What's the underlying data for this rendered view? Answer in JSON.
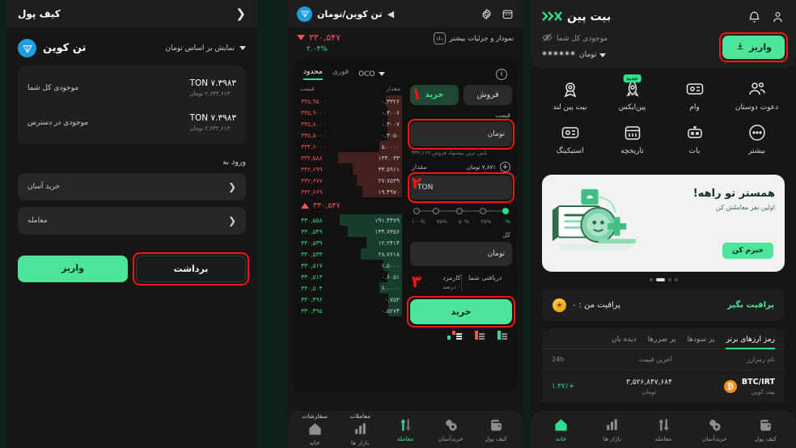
{
  "left": {
    "brand": {
      "name": "بیت پین",
      "mark": "》K"
    },
    "header_icons": [
      "user-icon",
      "bell-icon"
    ],
    "balance": {
      "label": "موجودی کل شما",
      "eye_icon": "eye-off-icon",
      "masked_value": "******",
      "unit": "تومان"
    },
    "deposit_button": "واریز",
    "menu": [
      {
        "label": "دعوت دوستان",
        "icon": "users-icon"
      },
      {
        "label": "وام",
        "icon": "loan-icon"
      },
      {
        "label": "پین‌ایکس",
        "icon": "rocket-icon",
        "badge": "جدید"
      },
      {
        "label": "بیت پین لند",
        "icon": "medal-icon"
      },
      {
        "label": "استیکینگ",
        "icon": "staking-icon"
      },
      {
        "label": "تاریخچه",
        "icon": "calendar-icon"
      },
      {
        "label": "بات",
        "icon": "robot-icon"
      },
      {
        "label": "بیشتر",
        "icon": "dots-icon"
      }
    ],
    "promo": {
      "title": "همستر تو راهه!",
      "subtitle": "اولین نفر معاملش کن",
      "button": "خبرم کن",
      "dots_count": 4,
      "active_dot": 2
    },
    "profit": {
      "icon": "coin-icon",
      "text": "پرافیت من : ۰",
      "cta": "پرافیت بگیر"
    },
    "market_table": {
      "tabs": [
        "رمز ارزهای برتر",
        "پر سودها",
        "پر ضررها",
        "دیده بان"
      ],
      "active_tab": 0,
      "columns": [
        "نام رمزارز",
        "آخرین قیمت",
        "24h"
      ],
      "rows": [
        {
          "symbol": "BTC/IRT",
          "name": "بیت کوین",
          "price": "۳,۵۲۶,۸۴۷,۶۸۴",
          "price_unit": "تومان",
          "change": "+۱.۳۷٪",
          "icon": "bitcoin-icon"
        }
      ]
    },
    "bottom_nav": [
      {
        "label": "خانه",
        "icon": "home-icon",
        "active": true
      },
      {
        "label": "بازار ها",
        "icon": "chart-bars-icon",
        "active": false
      },
      {
        "label": "معامله",
        "icon": "swap-arrows-icon",
        "active": false
      },
      {
        "label": "خریدآسان",
        "icon": "coins-icon",
        "active": false
      },
      {
        "label": "کیف پول",
        "icon": "wallet-icon",
        "active": false
      }
    ]
  },
  "middle": {
    "header": {
      "pair": "تن کوین/تومان",
      "back_icon": "chevron-left-icon",
      "coin_icon": "ton-icon",
      "icons": [
        "calendar-icon",
        "gear-icon"
      ]
    },
    "price": "۳۳۰,۵۴۷",
    "change_pct": "۲.۰۴%",
    "more_link": "نمودار و جزئیات بیشتر",
    "order_tabs": [
      "محدود",
      "فوری",
      "OCO"
    ],
    "active_order_tab": 0,
    "info_icon": "info-icon",
    "orderbook": {
      "columns": [
        "قیمت",
        "مقدار"
      ],
      "sell": [
        {
          "price": "۳۳۵,۹۵۰۰",
          "amount": "۰.۳۳۲۶",
          "depth": 16
        },
        {
          "price": "۳۳۵,۹۰۰۰",
          "amount": "۰.۳۰۰۶",
          "depth": 14
        },
        {
          "price": "۳۳۵,۸۰۰۰",
          "amount": "۰.۳۰۰۷",
          "depth": 14
        },
        {
          "price": "۳۳۵,۵۰۰۰",
          "amount": "۰.۳۰۵۰",
          "depth": 14
        },
        {
          "price": "۳۳۴,۶۰۰۰",
          "amount": "۵.۰۰۰۰",
          "depth": 22
        },
        {
          "price": "۳۳۴,۵۸۸",
          "amount": "۱۳۴.۰۳۳",
          "depth": 62
        },
        {
          "price": "۳۳۲,۶۹۹",
          "amount": "۳۳.۵۹۱۱",
          "depth": 48
        },
        {
          "price": "۳۳۲,۶۷۷",
          "amount": "۲۷.۷۵۳۹",
          "depth": 44
        },
        {
          "price": "۳۳۲,۶۶۹",
          "amount": "۱۹.۴۹۷۰",
          "depth": 38
        }
      ],
      "mid_price": "۳۳۰,۵۴۷",
      "buy": [
        {
          "price": "۳۳۰,۵۵۸",
          "amount": "۱۹۱.۴۴۷۹",
          "depth": 60
        },
        {
          "price": "۳۳۰,۵۴۹",
          "amount": "۱۳۴.۷۳۵۶",
          "depth": 52
        },
        {
          "price": "۳۳۰,۵۳۹",
          "amount": "۱۲.۲۴۱۴",
          "depth": 34
        },
        {
          "price": "۳۳۰,۵۳۳",
          "amount": "۲۸.۷۶۱۸",
          "depth": 40
        },
        {
          "price": "۳۳۰,۵۱۷",
          "amount": "۱.۵۰۰۰",
          "depth": 18
        },
        {
          "price": "۳۳۰,۵۱۳",
          "amount": "۰.۶۰۵۱",
          "depth": 14
        },
        {
          "price": "۳۳۰,۵۰۴",
          "amount": "۶.۰۰۰۰",
          "depth": 22
        },
        {
          "price": "۳۳۰,۴۹۶",
          "amount": "۰.۷۵۲",
          "depth": 13
        },
        {
          "price": "۳۳۰,۴۹۵",
          "amount": "۰.۵۲۷۴",
          "depth": 13
        }
      ]
    },
    "form": {
      "buy_tab": "خرید",
      "sell_tab": "فروش",
      "price_label": "قیمت",
      "price_placeholder": "تومان",
      "price_hint": "پایین ترین پیشنهاد فروش ۳۳۲,۶۶۹",
      "amount_label": "مقدار",
      "amount_equiv": "۷,۸۷۱ تومان",
      "amount_placeholder": "TON",
      "plus_icon": "plus-circle-icon",
      "slider_labels": [
        "۰%",
        "۲۵%",
        "۵۰%",
        "۷۵%",
        "۱۰۰%"
      ],
      "slider_value": 0,
      "total_label": "کل",
      "total_placeholder": "تومان",
      "fee_label": "کارمزد",
      "fee_value": "۰ درصد",
      "receive_label": "دریافتی شما",
      "receive_value": "۰",
      "submit": "خرید"
    },
    "view_icons": [
      "orderbook-buy-view-icon",
      "orderbook-sell-view-icon",
      "orderbook-both-view-icon"
    ],
    "annotations": [
      "۱",
      "۲",
      "۳"
    ],
    "bottom_nav": [
      {
        "label": "خانه",
        "icon": "home-icon",
        "active": false,
        "top": "سفارشات"
      },
      {
        "label": "بازار ها",
        "icon": "chart-bars-icon",
        "active": false,
        "top": "معاملات"
      },
      {
        "label": "معامله",
        "icon": "swap-arrows-icon",
        "active": true,
        "top": ""
      },
      {
        "label": "خریدآسان",
        "icon": "coins-icon",
        "active": false,
        "top": ""
      },
      {
        "label": "کیف پول",
        "icon": "wallet-icon",
        "active": false,
        "top": ""
      }
    ]
  },
  "right": {
    "title": "کیف پول",
    "back_icon": "chevron-left-icon",
    "coin": {
      "name": "تن کوین",
      "icon": "ton-icon"
    },
    "filter": "نمایش بر اساس تومان",
    "balances": [
      {
        "label": "موجودی کل شما",
        "value": "۷.۳۹۸۳ TON",
        "sub": "۲,۶۳۲,۶۱۳ تومان"
      },
      {
        "label": "موجودی در دسترس",
        "value": "۷.۳۹۸۳ TON",
        "sub": "۲,۶۳۲,۶۱۳ تومان"
      }
    ],
    "section_label": "ورود به",
    "links": [
      "خرید آسان",
      "معامله"
    ],
    "deposit_button": "واریز",
    "withdraw_button": "برداشت"
  }
}
